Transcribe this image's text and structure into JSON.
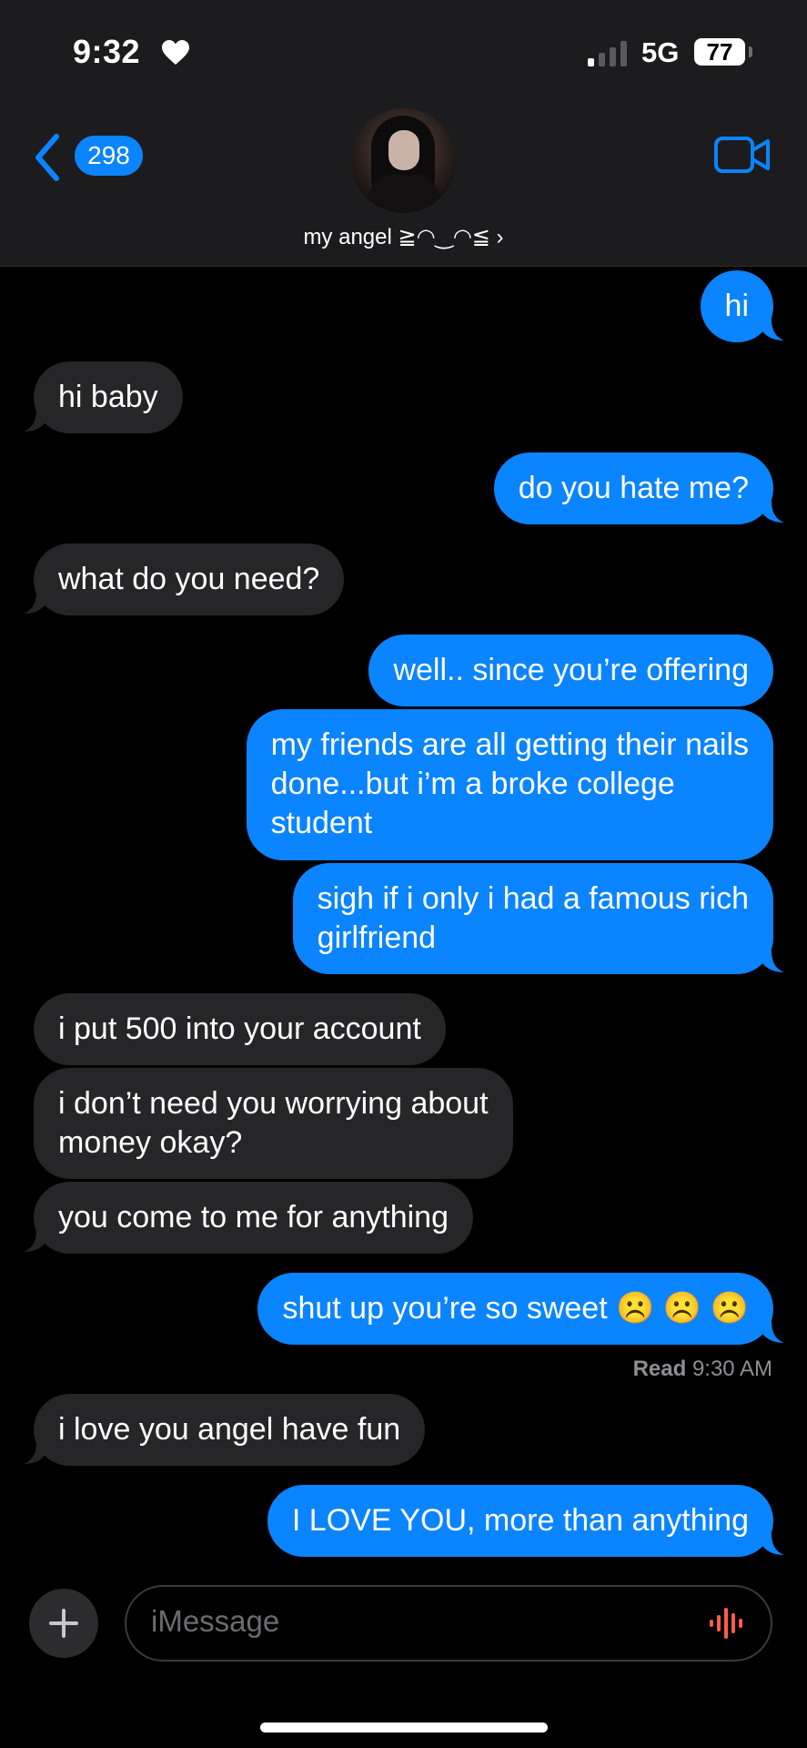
{
  "status_bar": {
    "time": "9:32",
    "network": "5G",
    "battery": "77"
  },
  "header": {
    "back_count": "298",
    "contact_name": "my angel ≧◠‿◠≦ ›"
  },
  "messages": [
    {
      "side": "sent",
      "text": "hi"
    },
    {
      "side": "received",
      "text": "hi baby"
    },
    {
      "side": "sent",
      "text": "do you hate me?"
    },
    {
      "side": "received",
      "text": "what do you need?"
    },
    {
      "side": "sent",
      "text": "well.. since you’re offering"
    },
    {
      "side": "sent",
      "text": "my friends are all getting their nails\ndone...but i’m a broke college\nstudent"
    },
    {
      "side": "sent",
      "text": "sigh if i only i had a famous rich\ngirlfriend"
    },
    {
      "side": "received",
      "text": "i put 500 into your account"
    },
    {
      "side": "received",
      "text": "i don’t need you worrying about\nmoney okay?"
    },
    {
      "side": "received",
      "text": "you come to me for anything"
    },
    {
      "side": "sent",
      "text": "shut up you’re so sweet ☹️ ☹️ ☹️"
    },
    {
      "side": "received",
      "text": "i love you angel have fun"
    },
    {
      "side": "sent",
      "text": "I LOVE YOU, more than anything"
    }
  ],
  "read_receipt": {
    "label": "Read",
    "time": "9:30 AM"
  },
  "compose": {
    "placeholder": "iMessage"
  },
  "colors": {
    "sent_bubble": "#0a84ff",
    "received_bubble": "#262628",
    "accent": "#0a84ff",
    "voice": "#ff5c4d"
  }
}
